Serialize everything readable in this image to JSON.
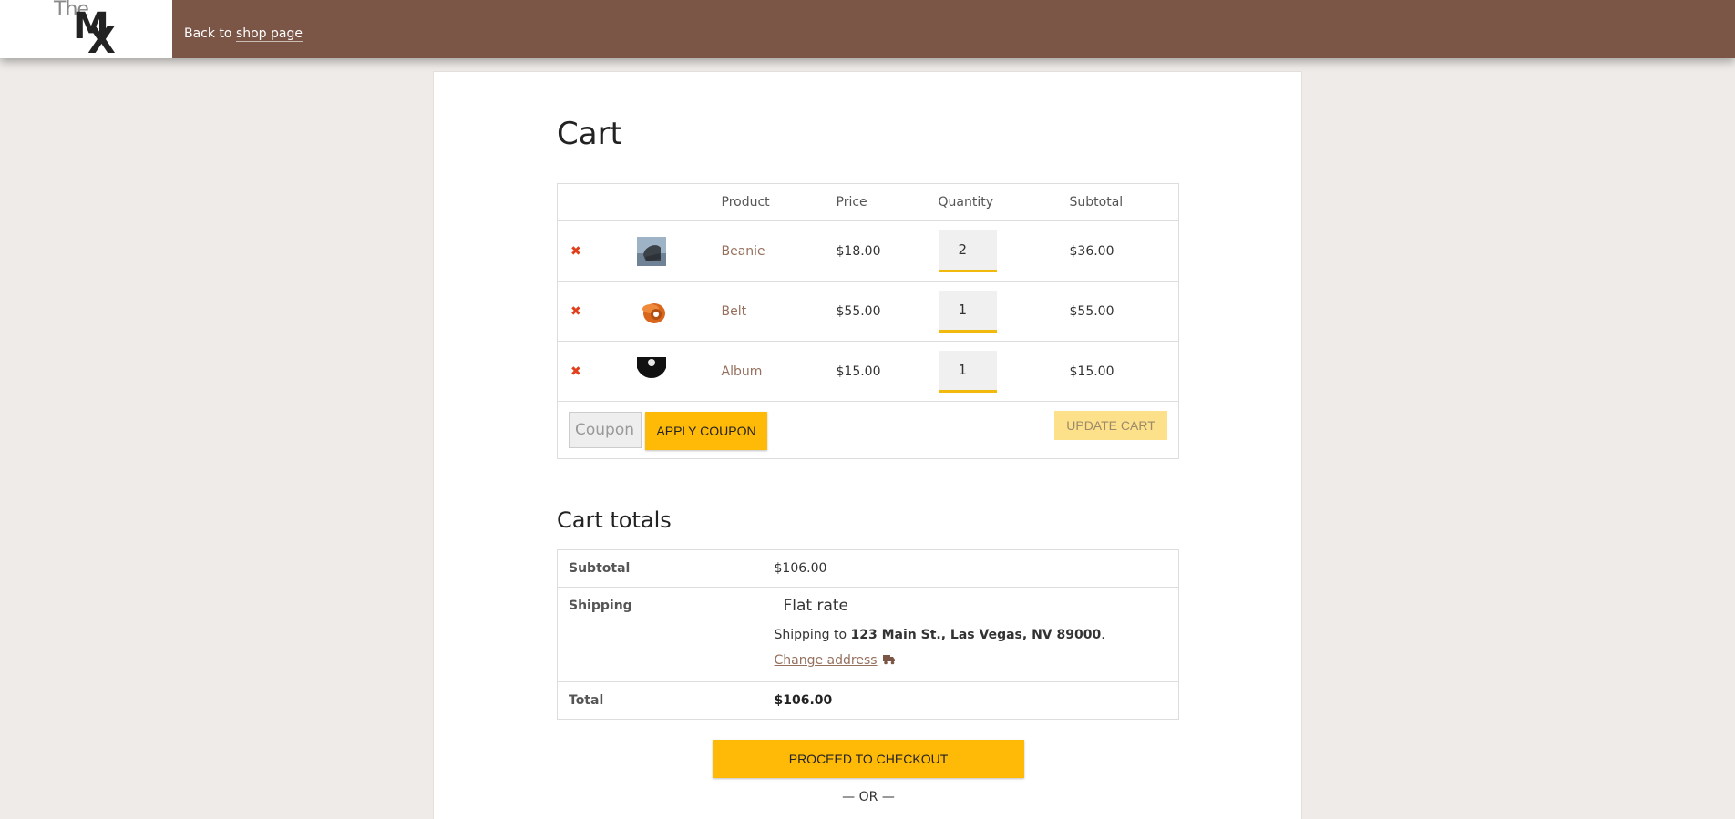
{
  "header": {
    "logo": {
      "the": "The",
      "m": "M",
      "x": "X"
    },
    "back_prefix": "Back to",
    "back_link": "shop page"
  },
  "cart": {
    "title": "Cart",
    "columns": [
      "Product",
      "Price",
      "Quantity",
      "Subtotal"
    ],
    "items": [
      {
        "name": "Beanie",
        "price": "$18.00",
        "quantity": "2",
        "subtotal": "$36.00",
        "thumb": "beanie"
      },
      {
        "name": "Belt",
        "price": "$55.00",
        "quantity": "1",
        "subtotal": "$55.00",
        "thumb": "belt"
      },
      {
        "name": "Album",
        "price": "$15.00",
        "quantity": "1",
        "subtotal": "$15.00",
        "thumb": "album"
      }
    ],
    "remove_symbol": "✖",
    "coupon_placeholder": "Coupon",
    "apply_coupon": "APPLY COUPON",
    "update_cart": "UPDATE CART"
  },
  "totals": {
    "title": "Cart totals",
    "subtotal_label": "Subtotal",
    "subtotal_value": "$106.00",
    "shipping_label": "Shipping",
    "shipping_method": "Flat rate",
    "shipping_to_prefix": "Shipping to",
    "shipping_address": "123 Main St., Las Vegas, NV 89000",
    "shipping_to_suffix": ".",
    "change_address": "Change address",
    "total_label": "Total",
    "total_value": "$106.00"
  },
  "checkout": {
    "button": "PROCEED TO CHECKOUT",
    "or_text": "— OR —"
  },
  "colors": {
    "topbar": "#7b5546",
    "accent_button": "#ffba08",
    "link": "#96705d",
    "remove": "#e2401c"
  }
}
